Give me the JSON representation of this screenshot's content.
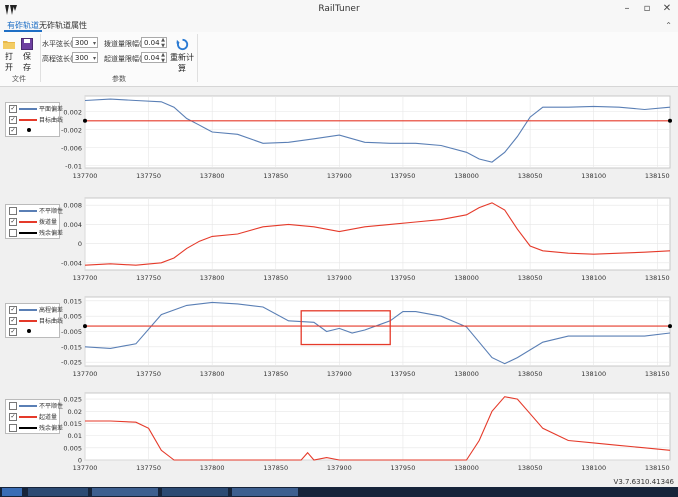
{
  "window": {
    "title": "RailTuner"
  },
  "tabs": [
    {
      "label": "有砟轨道",
      "active": true
    },
    {
      "label": "无砟轨道",
      "active": false
    },
    {
      "label": "属性",
      "active": false
    }
  ],
  "ribbon": {
    "open_label": "打开",
    "save_label": "保存",
    "file_group": "文件",
    "params_group": "参数",
    "recalc_label": "重新计算",
    "params": {
      "horizontal_chord": {
        "label": "水平弦长(m)",
        "value": "300"
      },
      "vertical_chord": {
        "label": "高程弦长(m)",
        "value": "300"
      },
      "lateral_range": {
        "label": "拨道量限幅(m)",
        "value": "0.04"
      },
      "lift_range": {
        "label": "起道量限幅(m)",
        "value": "0.04"
      }
    }
  },
  "charts": [
    {
      "legend": [
        {
          "label": "平面偏差",
          "color": "#5a7fb5",
          "checked": true
        },
        {
          "label": "目标曲线",
          "color": "#e53a2a",
          "checked": true
        },
        {
          "label": "",
          "color": "#000000",
          "checked": true,
          "dot": true
        }
      ]
    },
    {
      "legend": [
        {
          "label": "不平顺性",
          "color": "#5a7fb5",
          "checked": false
        },
        {
          "label": "拨道量",
          "color": "#e53a2a",
          "checked": true
        },
        {
          "label": "残余偏差",
          "color": "#000000",
          "checked": false
        }
      ]
    },
    {
      "legend": [
        {
          "label": "高程偏差",
          "color": "#5a7fb5",
          "checked": true
        },
        {
          "label": "目标曲线",
          "color": "#e53a2a",
          "checked": true
        },
        {
          "label": "",
          "color": "#000000",
          "checked": true,
          "dot": true
        }
      ]
    },
    {
      "legend": [
        {
          "label": "不平顺性",
          "color": "#5a7fb5",
          "checked": false
        },
        {
          "label": "起道量",
          "color": "#e53a2a",
          "checked": true
        },
        {
          "label": "残余偏差",
          "color": "#000000",
          "checked": false
        }
      ]
    }
  ],
  "chart_data": [
    {
      "type": "line",
      "xlim": [
        137700,
        138160
      ],
      "x_ticks": [
        137700,
        137750,
        137800,
        137850,
        137900,
        137950,
        138000,
        138050,
        138100,
        138150
      ],
      "ylim": [
        -0.0105,
        0.0055
      ],
      "y_ticks": [
        0.002,
        -0.002,
        -0.006,
        -0.01
      ],
      "y_tick_labels": [
        "0.002",
        "-0.002",
        "-0.006",
        "-0.01"
      ],
      "series": [
        {
          "name": "平面偏差",
          "color": "#5a7fb5",
          "points": [
            [
              137700,
              0.0045
            ],
            [
              137720,
              0.0048
            ],
            [
              137740,
              0.0045
            ],
            [
              137760,
              0.0042
            ],
            [
              137770,
              0.003
            ],
            [
              137780,
              0.0005
            ],
            [
              137790,
              -0.001
            ],
            [
              137800,
              -0.0025
            ],
            [
              137820,
              -0.003
            ],
            [
              137840,
              -0.005
            ],
            [
              137860,
              -0.0048
            ],
            [
              137880,
              -0.004
            ],
            [
              137900,
              -0.0032
            ],
            [
              137920,
              -0.0048
            ],
            [
              137940,
              -0.005
            ],
            [
              137960,
              -0.005
            ],
            [
              137980,
              -0.0055
            ],
            [
              138000,
              -0.007
            ],
            [
              138010,
              -0.0085
            ],
            [
              138020,
              -0.0092
            ],
            [
              138030,
              -0.007
            ],
            [
              138040,
              -0.0035
            ],
            [
              138050,
              0.0008
            ],
            [
              138060,
              0.003
            ],
            [
              138080,
              0.003
            ],
            [
              138100,
              0.0032
            ],
            [
              138120,
              0.003
            ],
            [
              138140,
              0.0025
            ],
            [
              138160,
              0.003
            ]
          ]
        },
        {
          "name": "目标曲线",
          "color": "#e53a2a",
          "points": [
            [
              137700,
              0.0
            ],
            [
              138160,
              0.0
            ]
          ]
        }
      ]
    },
    {
      "type": "line",
      "xlim": [
        137700,
        138160
      ],
      "x_ticks": [
        137700,
        137750,
        137800,
        137850,
        137900,
        137950,
        138000,
        138050,
        138100,
        138150
      ],
      "ylim": [
        -0.0055,
        0.0095
      ],
      "y_ticks": [
        0.008,
        0.004,
        0.0,
        -0.004
      ],
      "y_tick_labels": [
        "0.008",
        "0.004",
        "0",
        "-0.004"
      ],
      "series": [
        {
          "name": "拨道量",
          "color": "#e53a2a",
          "points": [
            [
              137700,
              -0.0045
            ],
            [
              137720,
              -0.0042
            ],
            [
              137740,
              -0.0045
            ],
            [
              137760,
              -0.004
            ],
            [
              137770,
              -0.003
            ],
            [
              137780,
              -0.001
            ],
            [
              137790,
              0.0005
            ],
            [
              137800,
              0.0015
            ],
            [
              137820,
              0.002
            ],
            [
              137840,
              0.0035
            ],
            [
              137860,
              0.004
            ],
            [
              137880,
              0.0035
            ],
            [
              137900,
              0.0025
            ],
            [
              137920,
              0.0035
            ],
            [
              137940,
              0.004
            ],
            [
              137960,
              0.0045
            ],
            [
              137980,
              0.005
            ],
            [
              138000,
              0.006
            ],
            [
              138010,
              0.0075
            ],
            [
              138020,
              0.0085
            ],
            [
              138030,
              0.007
            ],
            [
              138040,
              0.003
            ],
            [
              138050,
              -0.0005
            ],
            [
              138060,
              -0.0015
            ],
            [
              138080,
              -0.002
            ],
            [
              138100,
              -0.0022
            ],
            [
              138120,
              -0.002
            ],
            [
              138140,
              -0.0018
            ],
            [
              138160,
              -0.0015
            ]
          ]
        }
      ]
    },
    {
      "type": "line",
      "xlim": [
        137700,
        138160
      ],
      "x_ticks": [
        137700,
        137750,
        137800,
        137850,
        137900,
        137950,
        138000,
        138050,
        138100,
        138150
      ],
      "ylim": [
        -0.0275,
        0.0175
      ],
      "y_ticks": [
        0.015,
        0.005,
        -0.005,
        -0.015,
        -0.025
      ],
      "y_tick_labels": [
        "0.015",
        "0.005",
        "-0.005",
        "-0.015",
        "-0.025"
      ],
      "series": [
        {
          "name": "高程偏差",
          "color": "#5a7fb5",
          "points": [
            [
              137700,
              -0.015
            ],
            [
              137720,
              -0.016
            ],
            [
              137740,
              -0.013
            ],
            [
              137760,
              0.006
            ],
            [
              137780,
              0.012
            ],
            [
              137800,
              0.014
            ],
            [
              137820,
              0.013
            ],
            [
              137840,
              0.011
            ],
            [
              137860,
              0.002
            ],
            [
              137880,
              0.001
            ],
            [
              137890,
              -0.005
            ],
            [
              137900,
              -0.003
            ],
            [
              137910,
              -0.006
            ],
            [
              137920,
              -0.004
            ],
            [
              137940,
              0.002
            ],
            [
              137950,
              0.008
            ],
            [
              137960,
              0.008
            ],
            [
              137980,
              0.005
            ],
            [
              138000,
              -0.002
            ],
            [
              138010,
              -0.012
            ],
            [
              138020,
              -0.022
            ],
            [
              138030,
              -0.026
            ],
            [
              138040,
              -0.022
            ],
            [
              138060,
              -0.012
            ],
            [
              138080,
              -0.008
            ],
            [
              138100,
              -0.008
            ],
            [
              138120,
              -0.008
            ],
            [
              138140,
              -0.008
            ],
            [
              138160,
              -0.006
            ]
          ]
        },
        {
          "name": "目标曲线",
          "color": "#e53a2a",
          "points": [
            [
              137700,
              -0.0015
            ],
            [
              138160,
              -0.0015
            ]
          ]
        }
      ],
      "annotation": {
        "shape": "rectangle",
        "color": "#e53a2a",
        "x_range": [
          137870,
          137940
        ],
        "y_range": [
          -0.0135,
          0.0085
        ]
      }
    },
    {
      "type": "line",
      "xlim": [
        137700,
        138160
      ],
      "x_ticks": [
        137700,
        137750,
        137800,
        137850,
        137900,
        137950,
        138000,
        138050,
        138100,
        138150
      ],
      "ylim": [
        0.0,
        0.0275
      ],
      "y_ticks": [
        0.025,
        0.02,
        0.015,
        0.01,
        0.005,
        0.0
      ],
      "y_tick_labels": [
        "0.025",
        "0.02",
        "0.015",
        "0.01",
        "0.005",
        "0"
      ],
      "series": [
        {
          "name": "起道量",
          "color": "#e53a2a",
          "points": [
            [
              137700,
              0.016
            ],
            [
              137720,
              0.016
            ],
            [
              137740,
              0.0155
            ],
            [
              137750,
              0.013
            ],
            [
              137760,
              0.004
            ],
            [
              137770,
              0.0
            ],
            [
              137800,
              0.0
            ],
            [
              137850,
              0.0
            ],
            [
              137870,
              0.0
            ],
            [
              137875,
              0.003
            ],
            [
              137880,
              0.0
            ],
            [
              137890,
              0.001
            ],
            [
              137900,
              0.0
            ],
            [
              137950,
              0.0
            ],
            [
              138000,
              0.0
            ],
            [
              138010,
              0.008
            ],
            [
              138020,
              0.02
            ],
            [
              138030,
              0.026
            ],
            [
              138040,
              0.025
            ],
            [
              138050,
              0.019
            ],
            [
              138060,
              0.013
            ],
            [
              138080,
              0.008
            ],
            [
              138100,
              0.007
            ],
            [
              138120,
              0.006
            ],
            [
              138140,
              0.005
            ],
            [
              138160,
              0.004
            ]
          ]
        }
      ]
    }
  ],
  "status": {
    "version": "V3.7.6310.41346"
  }
}
